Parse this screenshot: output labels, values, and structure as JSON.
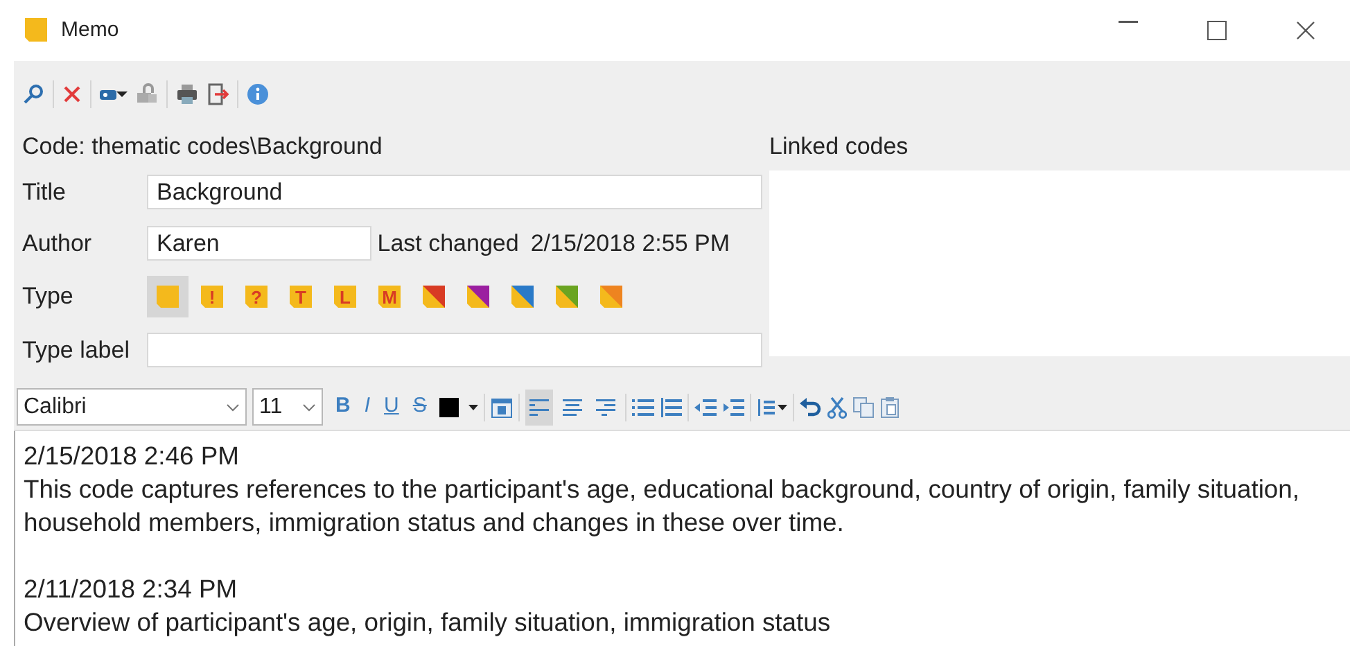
{
  "window": {
    "title": "Memo"
  },
  "code_path": "Code: thematic codes\\Background",
  "linked_codes": {
    "label": "Linked codes"
  },
  "fields": {
    "title_label": "Title",
    "title_value": "Background",
    "author_label": "Author",
    "author_value": "Karen",
    "last_changed_label": "Last changed",
    "last_changed_value": "2/15/2018 2:55 PM",
    "type_label": "Type",
    "type_label_label": "Type label"
  },
  "types": [
    {
      "kind": "plain",
      "selected": true
    },
    {
      "kind": "letter",
      "glyph": "!",
      "selected": false
    },
    {
      "kind": "letter",
      "glyph": "?",
      "selected": false
    },
    {
      "kind": "letter",
      "glyph": "T",
      "selected": false
    },
    {
      "kind": "letter",
      "glyph": "L",
      "selected": false
    },
    {
      "kind": "letter",
      "glyph": "M",
      "selected": false
    },
    {
      "kind": "split",
      "color": "#d83b24",
      "selected": false
    },
    {
      "kind": "split",
      "color": "#9b1fa0",
      "selected": false
    },
    {
      "kind": "split",
      "color": "#2a7ac8",
      "selected": false
    },
    {
      "kind": "split",
      "color": "#6aa421",
      "selected": false
    },
    {
      "kind": "split",
      "color": "#ee8420",
      "selected": false
    }
  ],
  "format": {
    "font": "Calibri",
    "size": "11",
    "styles": [
      "B",
      "I",
      "U",
      "S"
    ],
    "alignments": [
      {
        "selected": true
      },
      {
        "selected": false
      },
      {
        "selected": false
      }
    ]
  },
  "editor": {
    "entries": [
      {
        "timestamp": "2/15/2018 2:46 PM",
        "text": "This code captures references to the participant's age, educational background, country of origin, family situation, household members, immigration status and changes in these over time."
      },
      {
        "timestamp": "2/11/2018 2:34 PM",
        "text": "Overview of participant's age, origin, family situation, immigration status"
      }
    ]
  }
}
